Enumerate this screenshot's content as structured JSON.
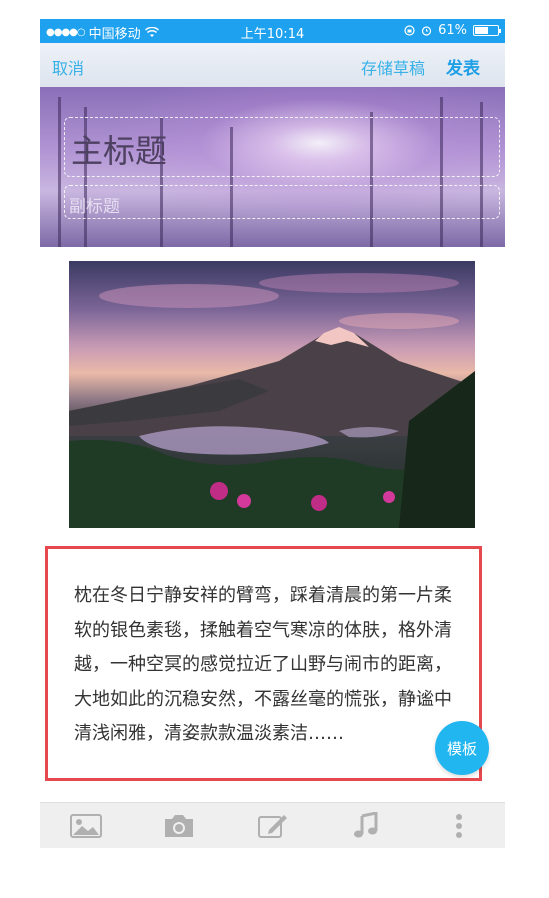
{
  "status_bar": {
    "signal": "●●●●○",
    "carrier": "中国移动",
    "time": "上午10:14",
    "battery": "61%",
    "battery_level": 0.61
  },
  "nav": {
    "cancel_label": "取消",
    "draft_label": "存储草稿",
    "publish_label": "发表"
  },
  "header": {
    "title_placeholder": "主标题",
    "subtitle_placeholder": "副标题"
  },
  "article": {
    "text": "枕在冬日宁静安祥的臂弯，踩着清晨的第一片柔软的银色素毯，揉触着空气寒凉的体肤，格外清越，一种空冥的感觉拉近了山野与闹市的距离，大地如此的沉稳安然，不露丝毫的慌张，静谧中清浅闲雅，清姿款款温淡素洁……"
  },
  "template_button": {
    "label": "模板"
  },
  "toolbar": {
    "items": [
      "image-icon",
      "camera-icon",
      "edit-icon",
      "music-icon",
      "more-icon"
    ]
  },
  "colors": {
    "accent": "#1ea1ee",
    "card_border": "#e5484d",
    "fab": "#22b6f0"
  }
}
